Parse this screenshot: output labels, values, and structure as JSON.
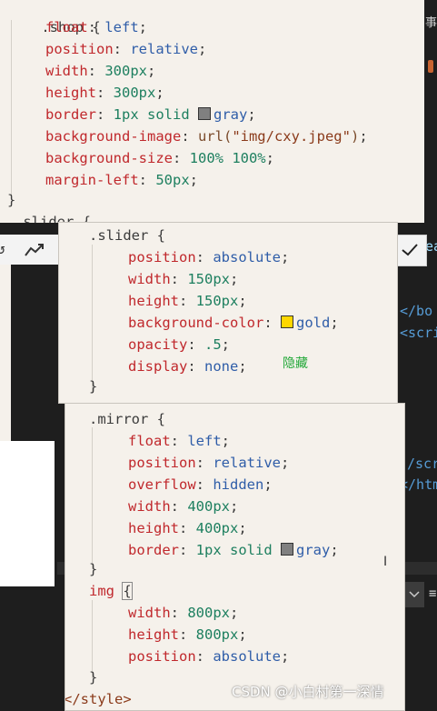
{
  "shop_block": {
    "selector": ".shop",
    "open_brace": "{",
    "close_brace": "}",
    "lines": [
      {
        "prop": "float",
        "value": "left"
      },
      {
        "prop": "position",
        "value": "relative"
      },
      {
        "prop": "width",
        "value": "300px"
      },
      {
        "prop": "height",
        "value": "300px"
      },
      {
        "prop": "border",
        "value_a": "1px solid ",
        "value_b": "gray",
        "swatch": "#808080"
      },
      {
        "prop": "background-image",
        "value_a": "url(",
        "value_b": "\"img/cxy.jpeg\"",
        "value_c": ")"
      },
      {
        "prop": "background-size",
        "value": "100% 100%"
      },
      {
        "prop": "margin-left",
        "value": "50px"
      }
    ],
    "partial_next": ".slider {"
  },
  "slider_block": {
    "selector": ".slider",
    "open_brace": "{",
    "close_brace": "}",
    "lines": [
      {
        "prop": "position",
        "value": "absolute"
      },
      {
        "prop": "width",
        "value": "150px"
      },
      {
        "prop": "height",
        "value": "150px"
      },
      {
        "prop": "background-color",
        "value": "gold",
        "swatch": "#ffd700"
      },
      {
        "prop": "opacity",
        "value": ".5"
      },
      {
        "prop": "display",
        "value": "none"
      }
    ],
    "note": "隐藏"
  },
  "mirror_block": {
    "selector": ".mirror",
    "open_brace": "{",
    "close_brace": "}",
    "lines": [
      {
        "prop": "float",
        "value": "left"
      },
      {
        "prop": "position",
        "value": "relative"
      },
      {
        "prop": "overflow",
        "value": "hidden"
      },
      {
        "prop": "width",
        "value": "400px"
      },
      {
        "prop": "height",
        "value": "400px"
      },
      {
        "prop": "border",
        "value_a": "1px solid ",
        "value_b": "gray",
        "swatch": "#808080"
      }
    ]
  },
  "img_block": {
    "selector": "img",
    "open_brace": "{",
    "close_brace": "}",
    "lines": [
      {
        "prop": "width",
        "value": "800px"
      },
      {
        "prop": "height",
        "value": "800px"
      },
      {
        "prop": "position",
        "value": "absolute"
      }
    ],
    "trailing": "</style>"
  },
  "editor_right": {
    "fragments": [
      "事",
      "ea",
      "</bo",
      "<scri",
      "/scr",
      "</htm"
    ]
  },
  "watermark": "CSDN @小白村第一深情",
  "colors": {
    "gold": "#ffd700",
    "gray": "#808080",
    "note_green": "#22a838"
  },
  "icons": [
    "undo-icon",
    "trend-icon",
    "check-icon",
    "chevron-down-icon",
    "menu-icon",
    "text-cursor-icon"
  ]
}
